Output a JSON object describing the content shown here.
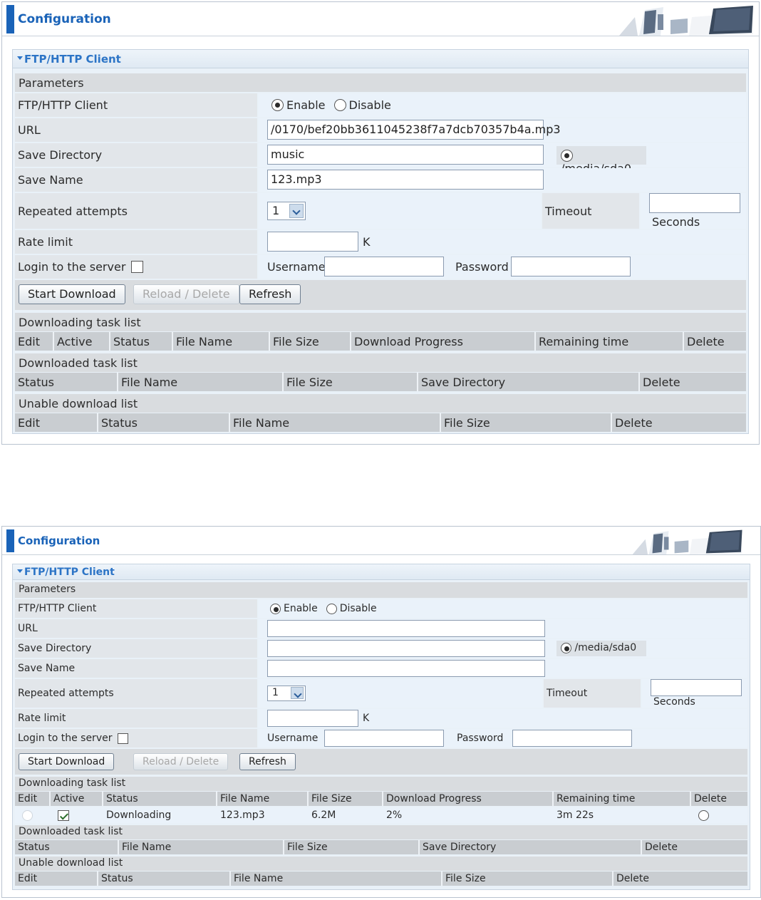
{
  "header": {
    "title": "Configuration"
  },
  "box": {
    "title": "FTP/HTTP Client"
  },
  "labels": {
    "parameters": "Parameters",
    "client": "FTP/HTTP Client",
    "enable": "Enable",
    "disable": "Disable",
    "url": "URL",
    "save_dir": "Save Directory",
    "media": "/media/sda0",
    "save_name": "Save Name",
    "repeated": "Repeated attempts",
    "timeout": "Timeout",
    "seconds": "Seconds",
    "rate_limit": "Rate limit",
    "k": "K",
    "login": "Login to the server",
    "username": "Username",
    "password": "Password"
  },
  "buttons": {
    "start": "Start Download",
    "reload": "Reload / Delete",
    "refresh": "Refresh"
  },
  "sections": {
    "downloading": "Downloading task list",
    "downloaded": "Downloaded task list",
    "unable": "Unable download list"
  },
  "columns": {
    "downloading": [
      "Edit",
      "Active",
      "Status",
      "File Name",
      "File Size",
      "Download Progress",
      "Remaining time",
      "Delete"
    ],
    "downloaded": [
      "Status",
      "File Name",
      "File Size",
      "Save Directory",
      "Delete"
    ],
    "unable": [
      "Edit",
      "Status",
      "File Name",
      "File Size",
      "Delete"
    ]
  },
  "form1": {
    "url": "/0170/bef20bb3611045238f7a7dcb70357b4a.mp3",
    "save_dir": "music",
    "save_name": "123.mp3",
    "repeated": "1",
    "timeout": "",
    "rate": "",
    "username": "",
    "password": ""
  },
  "form2": {
    "url": "",
    "save_dir": "",
    "save_name": "",
    "repeated": "1",
    "timeout": "",
    "rate": "",
    "username": "",
    "password": ""
  },
  "task": {
    "status": "Downloading",
    "file_name": "123.mp3",
    "file_size": "6.2M",
    "progress": "2%",
    "remaining": "3m 22s"
  }
}
